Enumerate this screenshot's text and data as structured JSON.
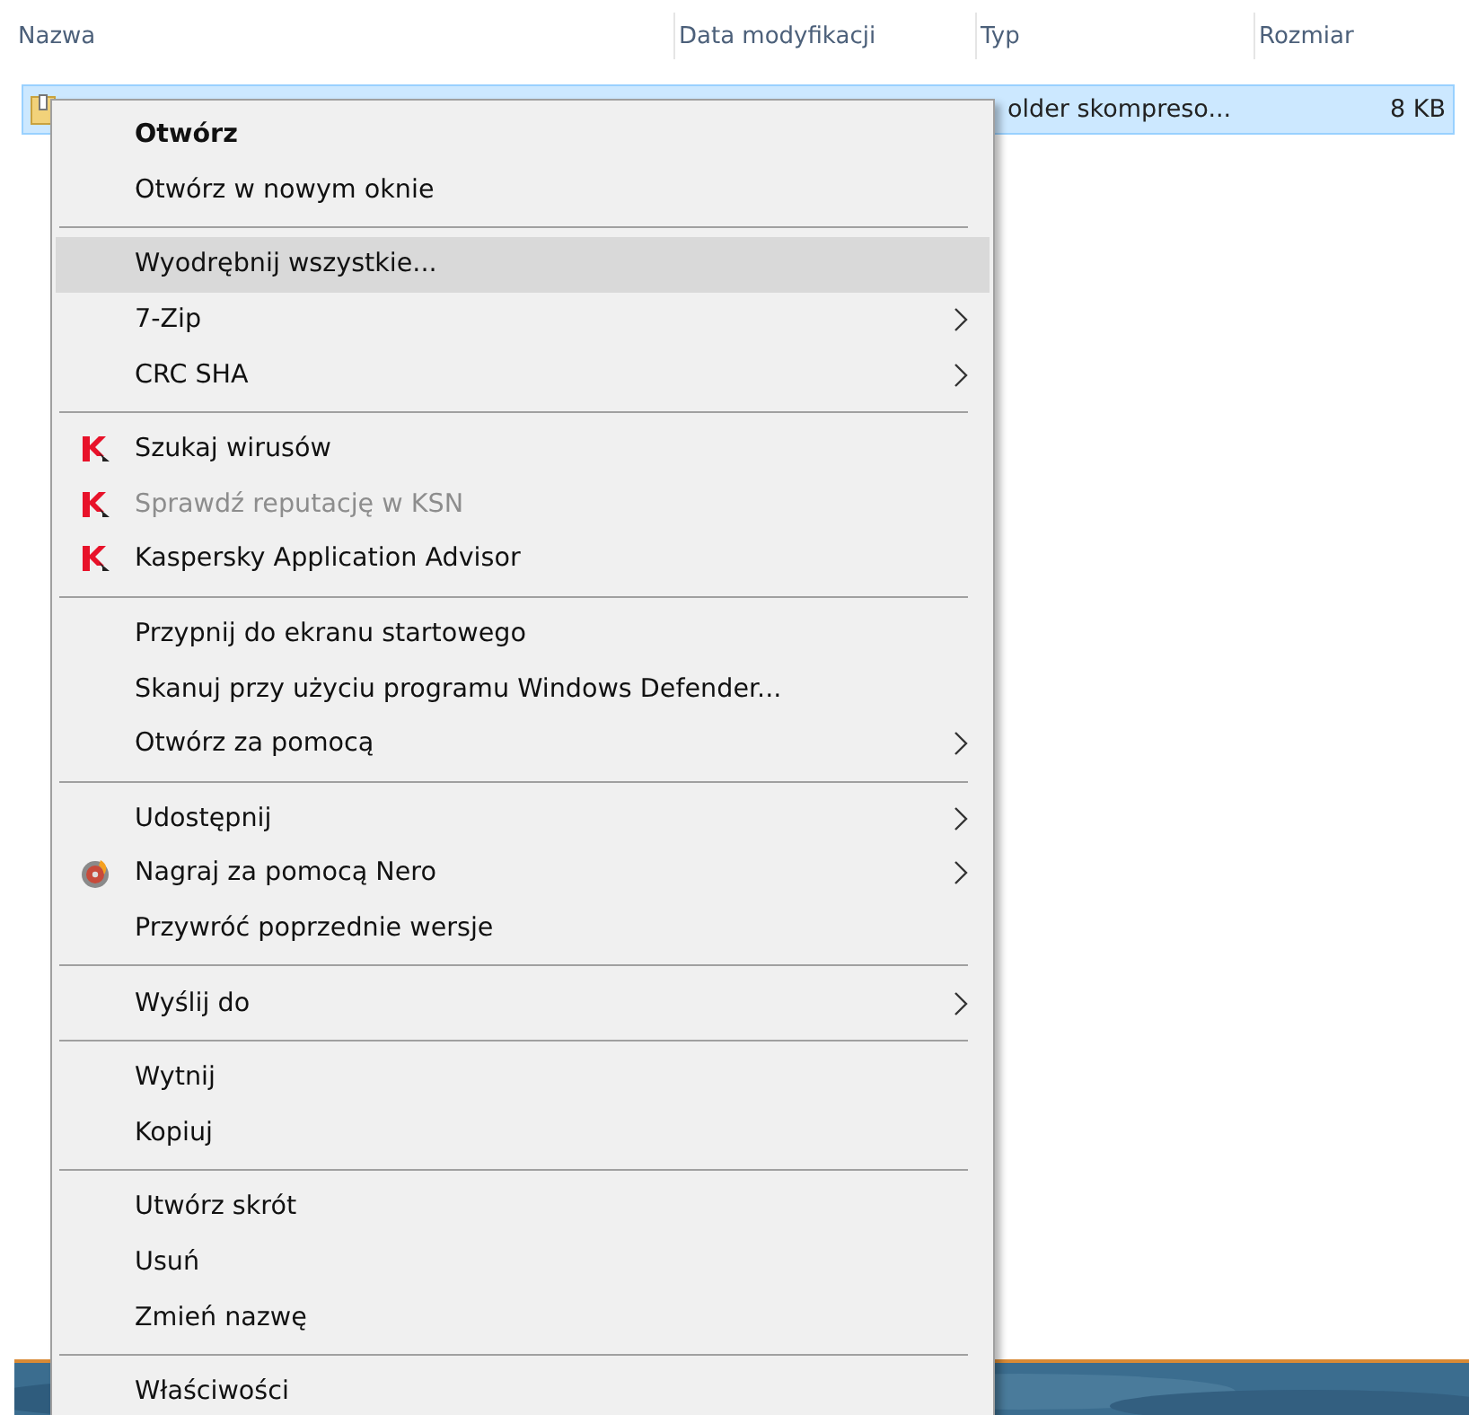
{
  "columns": [
    {
      "label": "Nazwa"
    },
    {
      "label": "Data modyfikacji"
    },
    {
      "label": "Typ"
    },
    {
      "label": "Rozmiar"
    }
  ],
  "file_row": {
    "selected": true,
    "type": "older skompreso...",
    "size": "8 KB"
  },
  "context_menu": [
    {
      "kind": "item",
      "label": "Otwórz",
      "default": true,
      "selected": false,
      "disabled": false,
      "submenu": false
    },
    {
      "kind": "item",
      "label": "Otwórz w nowym oknie",
      "default": false,
      "selected": false,
      "disabled": false,
      "submenu": false
    },
    {
      "kind": "separator"
    },
    {
      "kind": "item",
      "label": "Wyodrębnij wszystkie...",
      "default": false,
      "selected": true,
      "disabled": false,
      "submenu": false
    },
    {
      "kind": "item",
      "label": "7-Zip",
      "default": false,
      "selected": false,
      "disabled": false,
      "submenu": true
    },
    {
      "kind": "item",
      "label": "CRC SHA",
      "default": false,
      "selected": false,
      "disabled": false,
      "submenu": true
    },
    {
      "kind": "separator"
    },
    {
      "kind": "antivirus",
      "label": "Szukaj wirusów",
      "default": false,
      "selected": false,
      "disabled": false,
      "submenu": false
    },
    {
      "kind": "antivirus",
      "label": "Sprawdź reputację w KSN",
      "default": false,
      "selected": false,
      "disabled": true,
      "submenu": false
    },
    {
      "kind": "antivirus",
      "label": "Kaspersky Application Advisor",
      "default": false,
      "selected": false,
      "disabled": false,
      "submenu": false
    },
    {
      "kind": "separator"
    },
    {
      "kind": "item",
      "label": "Przypnij do ekranu startowego",
      "default": false,
      "selected": false,
      "disabled": false,
      "submenu": false
    },
    {
      "kind": "item",
      "label": "Skanuj przy użyciu programu Windows Defender...",
      "default": false,
      "selected": false,
      "disabled": false,
      "submenu": false
    },
    {
      "kind": "item",
      "label": "Otwórz za pomocą",
      "default": false,
      "selected": false,
      "disabled": false,
      "submenu": true
    },
    {
      "kind": "separator"
    },
    {
      "kind": "item",
      "label": "Udostępnij",
      "default": false,
      "selected": false,
      "disabled": false,
      "submenu": true
    },
    {
      "kind": "burner",
      "label": "Nagraj za pomocą Nero",
      "default": false,
      "selected": false,
      "disabled": false,
      "submenu": true
    },
    {
      "kind": "item",
      "label": "Przywróć poprzednie wersje",
      "default": false,
      "selected": false,
      "disabled": false,
      "submenu": false
    },
    {
      "kind": "separator"
    },
    {
      "kind": "item",
      "label": "Wyślij do",
      "default": false,
      "selected": false,
      "disabled": false,
      "submenu": true
    },
    {
      "kind": "separator"
    },
    {
      "kind": "item",
      "label": "Wytnij",
      "default": false,
      "selected": false,
      "disabled": false,
      "submenu": false
    },
    {
      "kind": "item",
      "label": "Kopiuj",
      "default": false,
      "selected": false,
      "disabled": false,
      "submenu": false
    },
    {
      "kind": "separator"
    },
    {
      "kind": "item",
      "label": "Utwórz skrót",
      "default": false,
      "selected": false,
      "disabled": false,
      "submenu": false
    },
    {
      "kind": "item",
      "label": "Usuń",
      "default": false,
      "selected": false,
      "disabled": false,
      "submenu": false
    },
    {
      "kind": "item",
      "label": "Zmień nazwę",
      "default": false,
      "selected": false,
      "disabled": false,
      "submenu": false
    },
    {
      "kind": "separator"
    },
    {
      "kind": "item",
      "label": "Właściwości",
      "default": false,
      "selected": false,
      "disabled": false,
      "submenu": false
    }
  ]
}
